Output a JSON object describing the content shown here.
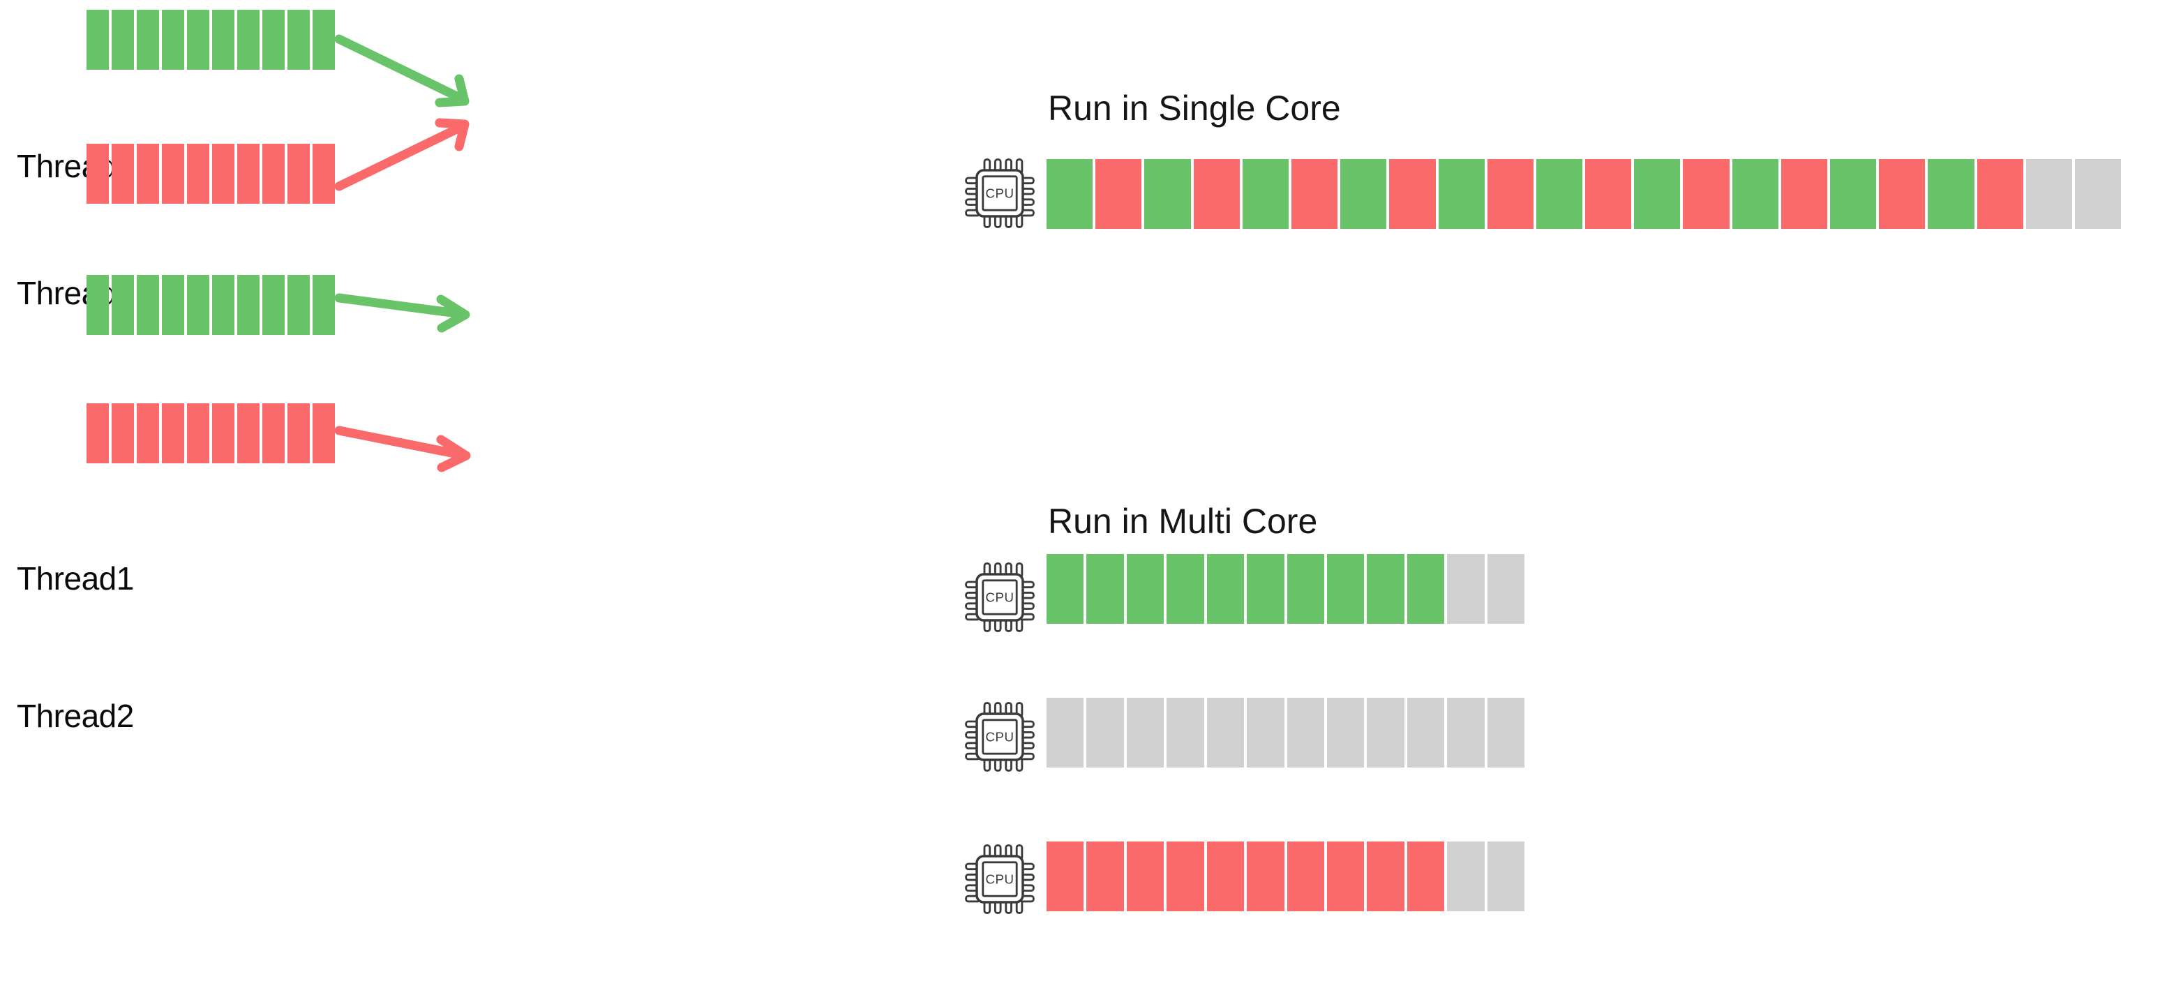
{
  "colors": {
    "green": "#69c368",
    "red": "#fa6a6a",
    "gray": "#d1d1d1",
    "background": "#ffffff",
    "text": "#0a0a0a",
    "cpu_outline": "#3a3a3a"
  },
  "single_core_section": {
    "title": "Run in Single Core",
    "threads": [
      {
        "label": "Thread1",
        "color_key": "green",
        "segments": 10
      },
      {
        "label": "Thread2",
        "color_key": "red",
        "segments": 10
      }
    ],
    "arrows": [
      {
        "name": "thread1-to-cpu-arrow",
        "color_key": "green"
      },
      {
        "name": "thread2-to-cpu-arrow",
        "color_key": "red"
      }
    ],
    "cpu": {
      "label": "CPU"
    },
    "timeline": {
      "name": "single-core-timeline",
      "total_slots": 22,
      "slots": [
        "green",
        "red",
        "green",
        "red",
        "green",
        "red",
        "green",
        "red",
        "green",
        "red",
        "green",
        "red",
        "green",
        "red",
        "green",
        "red",
        "green",
        "red",
        "green",
        "red",
        "gray",
        "gray"
      ]
    }
  },
  "multi_core_section": {
    "title": "Run in Multi Core",
    "threads": [
      {
        "label": "Thread1",
        "color_key": "green",
        "segments": 10
      },
      {
        "label": "Thread2",
        "color_key": "red",
        "segments": 10
      }
    ],
    "arrows": [
      {
        "name": "thread1-to-core1-arrow",
        "color_key": "green"
      },
      {
        "name": "thread2-to-core3-arrow",
        "color_key": "red"
      }
    ],
    "cores": [
      {
        "name": "core-1",
        "cpu": {
          "label": "CPU"
        },
        "timeline": {
          "name": "core-1-timeline",
          "total_slots": 12,
          "slots": [
            "green",
            "green",
            "green",
            "green",
            "green",
            "green",
            "green",
            "green",
            "green",
            "green",
            "gray",
            "gray"
          ]
        }
      },
      {
        "name": "core-2",
        "cpu": {
          "label": "CPU"
        },
        "timeline": {
          "name": "core-2-timeline",
          "total_slots": 12,
          "slots": [
            "gray",
            "gray",
            "gray",
            "gray",
            "gray",
            "gray",
            "gray",
            "gray",
            "gray",
            "gray",
            "gray",
            "gray"
          ]
        }
      },
      {
        "name": "core-3",
        "cpu": {
          "label": "CPU"
        },
        "timeline": {
          "name": "core-3-timeline",
          "total_slots": 12,
          "slots": [
            "red",
            "red",
            "red",
            "red",
            "red",
            "red",
            "red",
            "red",
            "red",
            "red",
            "gray",
            "gray"
          ]
        }
      }
    ]
  }
}
